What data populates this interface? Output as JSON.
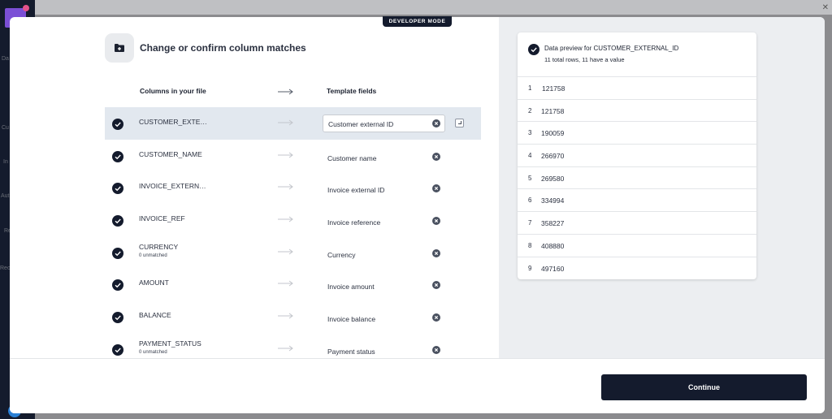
{
  "background": {
    "sidebar_fragments": [
      "Da",
      "Cu",
      "In",
      "Aut",
      "Re",
      "Reco"
    ]
  },
  "modal": {
    "badge": "DEVELOPER MODE",
    "title": "Change or confirm column matches",
    "header_icon": "folder-plus-icon",
    "columns_header": "Columns in your file",
    "fields_header": "Template fields",
    "rows": [
      {
        "column": "CUSTOMER_EXTE…",
        "sub": "",
        "field": "Customer external ID",
        "selected": true
      },
      {
        "column": "CUSTOMER_NAME",
        "sub": "",
        "field": "Customer name",
        "selected": false
      },
      {
        "column": "INVOICE_EXTERN…",
        "sub": "",
        "field": "Invoice external ID",
        "selected": false
      },
      {
        "column": "INVOICE_REF",
        "sub": "",
        "field": "Invoice reference",
        "selected": false
      },
      {
        "column": "CURRENCY",
        "sub": "0 unmatched",
        "field": "Currency",
        "selected": false
      },
      {
        "column": "AMOUNT",
        "sub": "",
        "field": "Invoice amount",
        "selected": false
      },
      {
        "column": "BALANCE",
        "sub": "",
        "field": "Invoice balance",
        "selected": false
      },
      {
        "column": "PAYMENT_STATUS",
        "sub": "0 unmatched",
        "field": "Payment status",
        "selected": false
      }
    ],
    "preview": {
      "title": "Data preview for CUSTOMER_EXTERNAL_ID",
      "subtitle": "11 total rows, 11 have a value",
      "rows": [
        {
          "index": "1",
          "value": "121758"
        },
        {
          "index": "2",
          "value": "121758"
        },
        {
          "index": "3",
          "value": "190059"
        },
        {
          "index": "4",
          "value": "266970"
        },
        {
          "index": "5",
          "value": "269580"
        },
        {
          "index": "6",
          "value": "334994"
        },
        {
          "index": "7",
          "value": "358227"
        },
        {
          "index": "8",
          "value": "408880"
        },
        {
          "index": "9",
          "value": "497160"
        }
      ]
    },
    "continue_label": "Continue"
  },
  "colors": {
    "primary": "#141b2d",
    "selected_row": "#e2e8ef",
    "panel_bg": "#eceef1"
  }
}
